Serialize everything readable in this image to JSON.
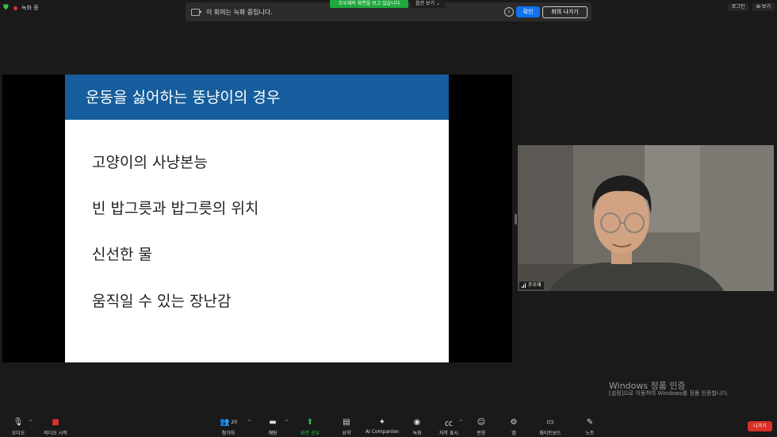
{
  "top_bar": {
    "recording_status": "녹화 중",
    "viewing_tag": "조우재의 화면을 보고 있습니다",
    "view_options_label": "옵션 보기 ⌄",
    "login_label": "로그인",
    "view_label": "⊞ 보기"
  },
  "recording_banner": {
    "text": "이 회의는 녹화 중입니다.",
    "confirm_label": "확인",
    "leave_label": "회의 나가기"
  },
  "slide": {
    "title": "운동을 싫어하는 뚱냥이의 경우",
    "bullets": [
      "고양이의 사냥본능",
      "빈 밥그릇과 밥그릇의 위치",
      "신선한 물",
      "움직일 수 있는 장난감"
    ]
  },
  "participant": {
    "name": "조우재"
  },
  "watermark": {
    "title": "Windows 정품 인증",
    "subtitle": "[설정]으로 이동하여 Windows를 정품 인증합니다."
  },
  "toolbar": {
    "audio_label": "오디오",
    "video_label": "비디오 시작",
    "participants_label": "참가자",
    "participants_count": "20",
    "chat_label": "채팅",
    "share_label": "화면 공유",
    "summary_label": "요약",
    "ai_label": "AI Companion",
    "record_label": "녹화",
    "captions_label": "자막 표시",
    "reactions_label": "반응",
    "apps_label": "앱",
    "whiteboard_label": "화이트보드",
    "notes_label": "노트",
    "leave_label": "나가기"
  },
  "colors": {
    "accent": "#0e72ed",
    "recording": "#e2302c",
    "share_green": "#1fa83d",
    "slide_header": "#155d9c",
    "leave": "#d93025"
  }
}
